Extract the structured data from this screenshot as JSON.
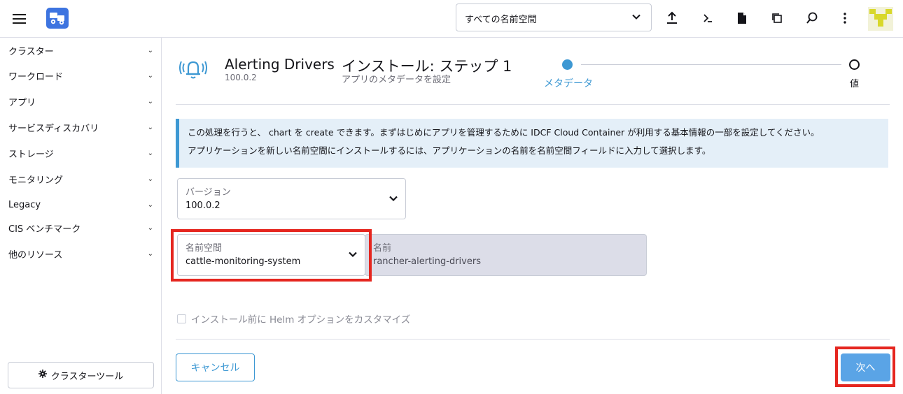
{
  "header": {
    "namespace_select": {
      "value": "すべての名前空間"
    },
    "icons": [
      "menu-icon",
      "app-logo-icon",
      "upload-icon",
      "terminal-icon",
      "file-icon",
      "copy-icon",
      "search-icon",
      "more-vert-icon",
      "avatar"
    ]
  },
  "sidebar": {
    "items": [
      {
        "label": "クラスター"
      },
      {
        "label": "ワークロード"
      },
      {
        "label": "アプリ"
      },
      {
        "label": "サービスディスカバリ"
      },
      {
        "label": "ストレージ"
      },
      {
        "label": "モニタリング"
      },
      {
        "label": "Legacy"
      },
      {
        "label": "CIS ベンチマーク"
      },
      {
        "label": "他のリソース"
      }
    ],
    "cluster_tools_label": "クラスターツール"
  },
  "chart": {
    "title": "Alerting Drivers",
    "version": "100.0.2"
  },
  "wizard": {
    "title": "インストール: ステップ 1",
    "subtitle": "アプリのメタデータを設定",
    "steps": [
      {
        "label": "メタデータ",
        "active": true
      },
      {
        "label": "値",
        "active": false
      }
    ]
  },
  "banner": {
    "line1": "この処理を行うと、 chart を create できます。まずはじめにアプリを管理するために IDCF Cloud Container が利用する基本情報の一部を設定してください。",
    "line2": "アプリケーションを新しい名前空間にインストールするには、アプリケーションの名前を名前空間フィールドに入力して選択します。"
  },
  "form": {
    "version": {
      "label": "バージョン",
      "value": "100.0.2"
    },
    "namespace": {
      "label": "名前空間",
      "value": "cattle-monitoring-system"
    },
    "name": {
      "label": "名前",
      "value": "rancher-alerting-drivers"
    },
    "helm_checkbox_label": "インストール前に Helm オプションをカスタマイズ",
    "helm_checkbox_checked": false
  },
  "actions": {
    "cancel_label": "キャンセル",
    "next_label": "次へ"
  },
  "colors": {
    "accent": "#3d98d3",
    "highlight": "#e5261f",
    "primary_button": "#5aa4e6"
  }
}
